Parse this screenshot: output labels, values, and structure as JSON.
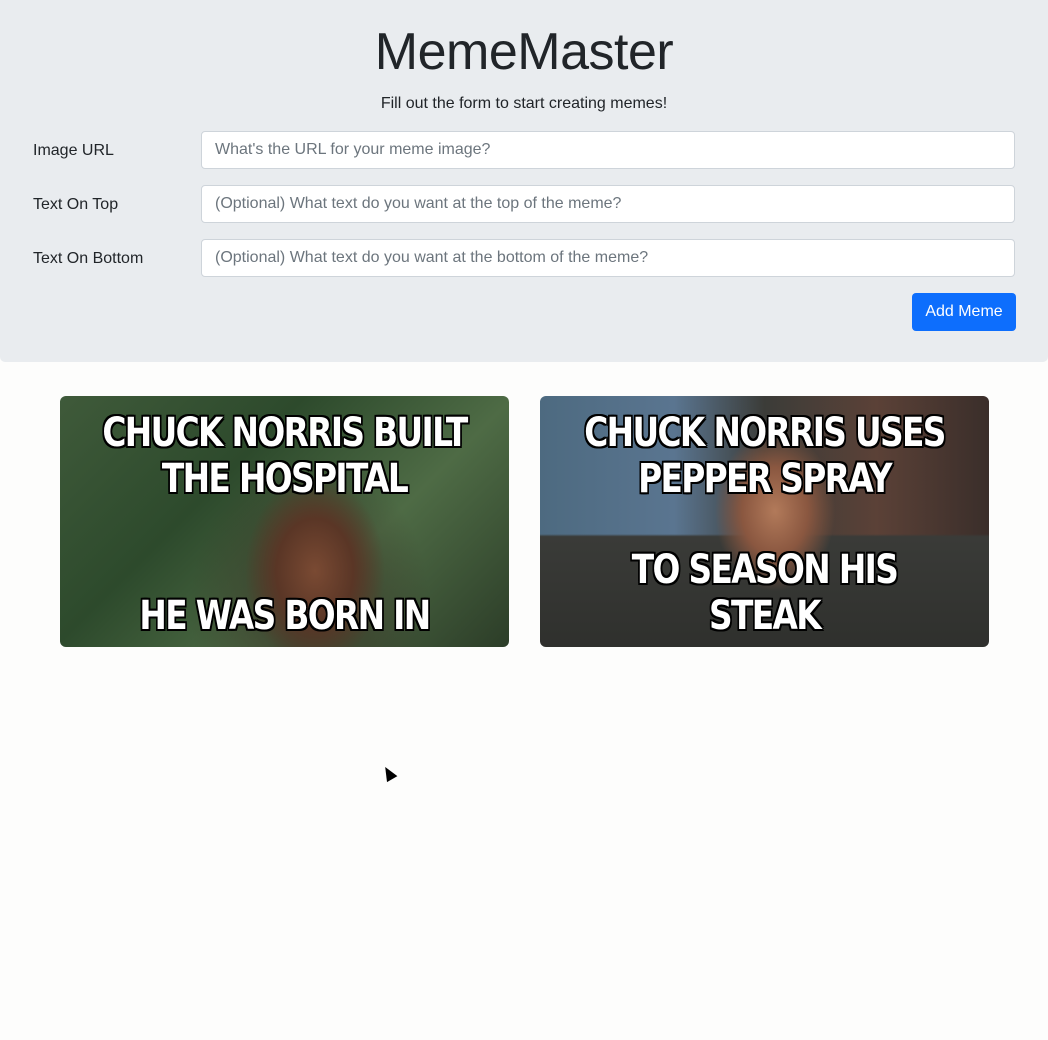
{
  "header": {
    "title": "MemeMaster",
    "subtitle": "Fill out the form to start creating memes!"
  },
  "form": {
    "image_url": {
      "label": "Image URL",
      "placeholder": "What's the URL for your meme image?",
      "value": ""
    },
    "top_text": {
      "label": "Text On Top",
      "placeholder": "(Optional) What text do you want at the top of the meme?",
      "value": ""
    },
    "bottom_text": {
      "label": "Text On Bottom",
      "placeholder": "(Optional) What text do you want at the bottom of the meme?",
      "value": ""
    },
    "submit_label": "Add Meme"
  },
  "memes": [
    {
      "top": "CHUCK NORRIS BUILT THE HOSPITAL",
      "bottom": "HE WAS BORN IN"
    },
    {
      "top": "CHUCK NORRIS USES PEPPER SPRAY",
      "bottom": "TO SEASON HIS STEAK"
    }
  ],
  "colors": {
    "accent": "#0d6efd",
    "header_bg": "#e9ecef"
  },
  "icons": {
    "cursor": "mouse-pointer-icon"
  }
}
